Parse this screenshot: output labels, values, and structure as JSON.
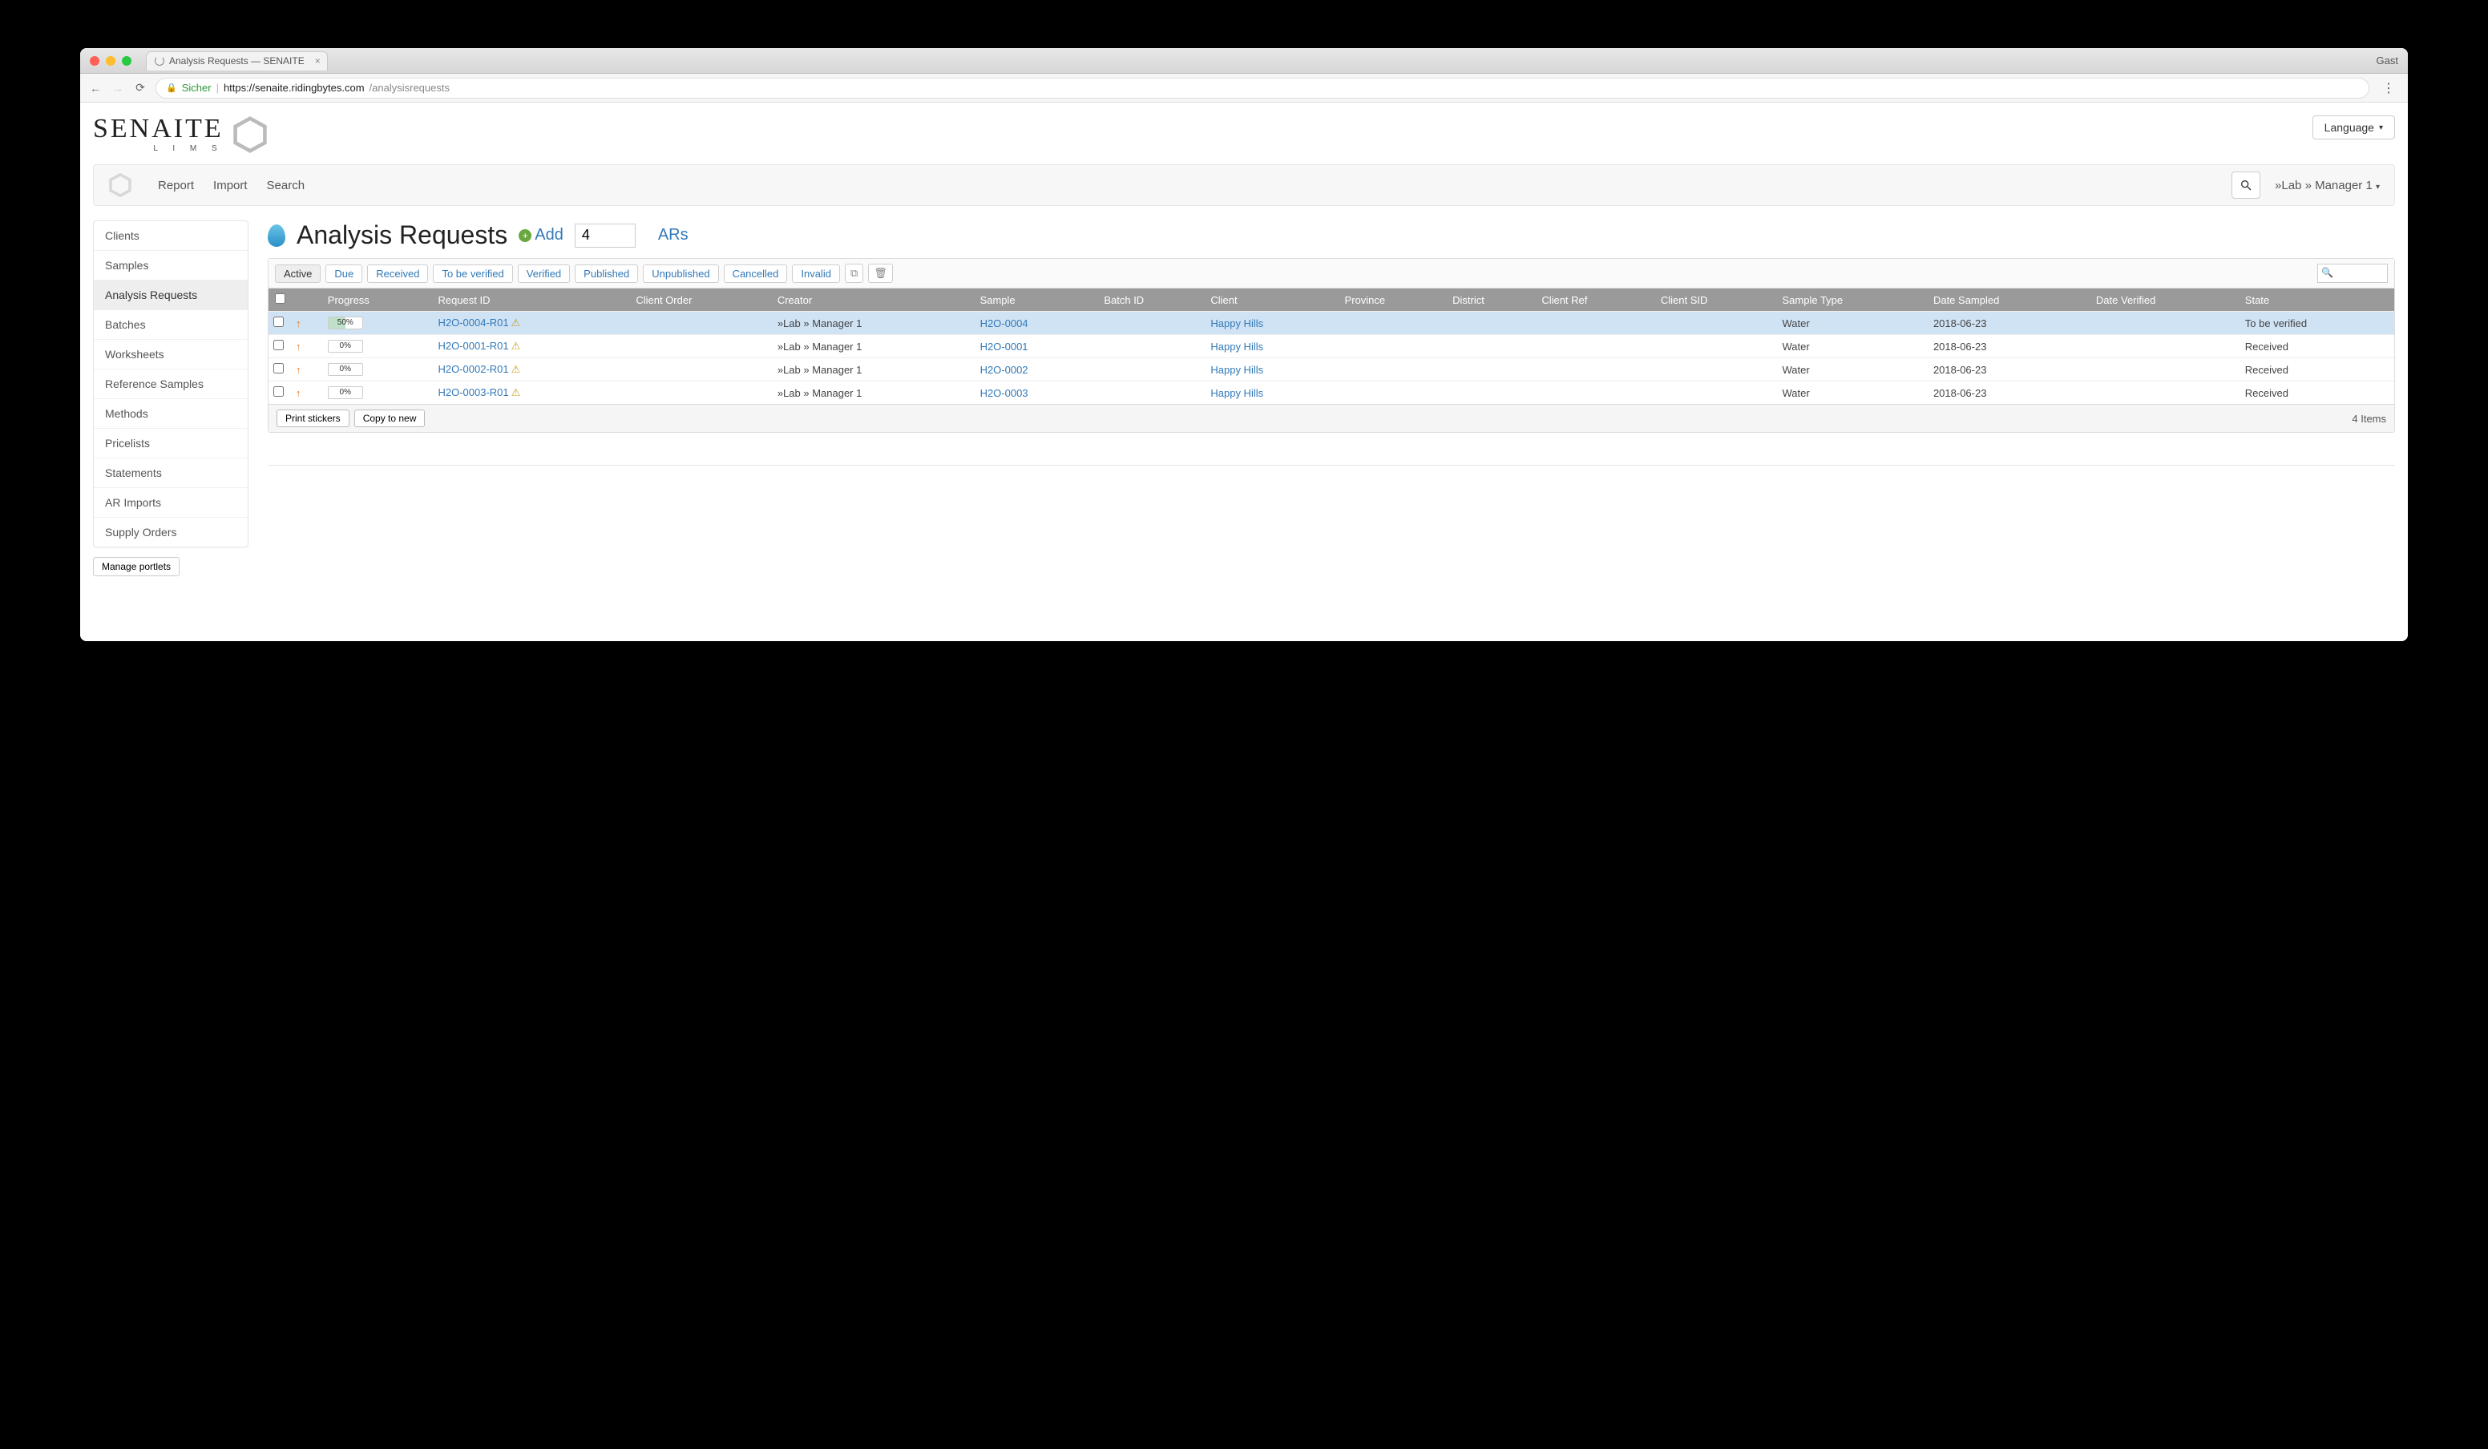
{
  "browser": {
    "tab_title": "Analysis Requests — SENAITE",
    "profile": "Gast",
    "secure_label": "Sicher",
    "url_host": "https://senaite.ridingbytes.com",
    "url_path": "/analysisrequests"
  },
  "header": {
    "logo_main": "SENAITE",
    "logo_sub": "L I M S",
    "language_label": "Language"
  },
  "nav": {
    "items": [
      "Report",
      "Import",
      "Search"
    ],
    "user": "»Lab » Manager 1"
  },
  "sidebar": {
    "items": [
      "Clients",
      "Samples",
      "Analysis Requests",
      "Batches",
      "Worksheets",
      "Reference Samples",
      "Methods",
      "Pricelists",
      "Statements",
      "AR Imports",
      "Supply Orders"
    ],
    "active_index": 2,
    "manage_portlets": "Manage portlets"
  },
  "page": {
    "title": "Analysis Requests",
    "add_label": "Add",
    "count_value": "4",
    "ars_label": "ARs"
  },
  "filters": [
    "Active",
    "Due",
    "Received",
    "To be verified",
    "Verified",
    "Published",
    "Unpublished",
    "Cancelled",
    "Invalid"
  ],
  "filters_active_index": 0,
  "columns": [
    "",
    "",
    "Progress",
    "Request ID",
    "Client Order",
    "Creator",
    "Sample",
    "Batch ID",
    "Client",
    "Province",
    "District",
    "Client Ref",
    "Client SID",
    "Sample Type",
    "Date Sampled",
    "Date Verified",
    "State"
  ],
  "rows": [
    {
      "priority": "↑",
      "progress": "50%",
      "progress_pct": 50,
      "request_id": "H2O-0004-R01",
      "client_order": "",
      "creator": "»Lab » Manager 1",
      "sample": "H2O-0004",
      "batch_id": "",
      "client": "Happy Hills",
      "province": "",
      "district": "",
      "client_ref": "",
      "client_sid": "",
      "sample_type": "Water",
      "date_sampled": "2018-06-23",
      "date_verified": "",
      "state": "To be verified",
      "highlight": true
    },
    {
      "priority": "↑",
      "progress": "0%",
      "progress_pct": 0,
      "request_id": "H2O-0001-R01",
      "client_order": "",
      "creator": "»Lab » Manager 1",
      "sample": "H2O-0001",
      "batch_id": "",
      "client": "Happy Hills",
      "province": "",
      "district": "",
      "client_ref": "",
      "client_sid": "",
      "sample_type": "Water",
      "date_sampled": "2018-06-23",
      "date_verified": "",
      "state": "Received",
      "highlight": false
    },
    {
      "priority": "↑",
      "progress": "0%",
      "progress_pct": 0,
      "request_id": "H2O-0002-R01",
      "client_order": "",
      "creator": "»Lab » Manager 1",
      "sample": "H2O-0002",
      "batch_id": "",
      "client": "Happy Hills",
      "province": "",
      "district": "",
      "client_ref": "",
      "client_sid": "",
      "sample_type": "Water",
      "date_sampled": "2018-06-23",
      "date_verified": "",
      "state": "Received",
      "highlight": false
    },
    {
      "priority": "↑",
      "progress": "0%",
      "progress_pct": 0,
      "request_id": "H2O-0003-R01",
      "client_order": "",
      "creator": "»Lab » Manager 1",
      "sample": "H2O-0003",
      "batch_id": "",
      "client": "Happy Hills",
      "province": "",
      "district": "",
      "client_ref": "",
      "client_sid": "",
      "sample_type": "Water",
      "date_sampled": "2018-06-23",
      "date_verified": "",
      "state": "Received",
      "highlight": false
    }
  ],
  "footer": {
    "print_stickers": "Print stickers",
    "copy_to_new": "Copy to new",
    "items_count": "4 Items"
  }
}
